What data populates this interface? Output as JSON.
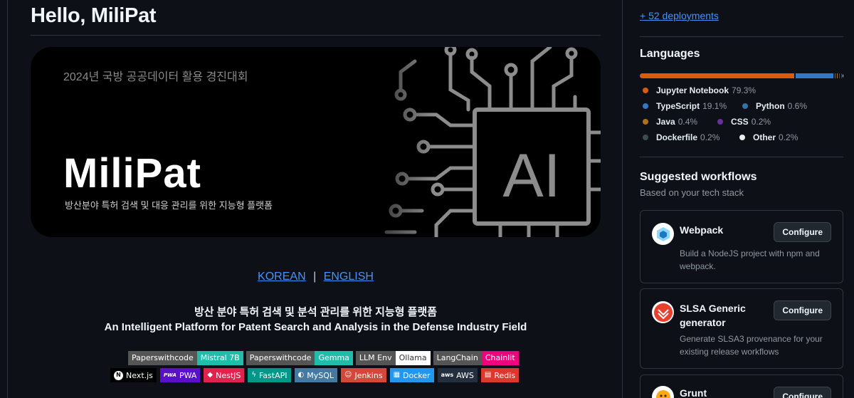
{
  "greeting": "Hello, MiliPat",
  "banner": {
    "subtitle": "2024년 국방 공공데이터 활용 경진대회",
    "title": "MiliPat",
    "tagline": "방산분야 특허 검색 및 대응 관리를 위한 지능형 플랫폼",
    "chip_label": "AI"
  },
  "language_links": {
    "korean": "KOREAN",
    "separator": "|",
    "english": "ENGLISH"
  },
  "description": {
    "korean": "방산 분야 특허 검색 및 분석 관리를 위한 지능형 플랫폼",
    "english": "An Intelligent Platform for Patent Search and Analysis in the Defense Industry Field"
  },
  "badges_row1": [
    {
      "key": "Paperswithcode",
      "value": "Mistral 7B",
      "color": "#20beaa"
    },
    {
      "key": "Paperswithcode",
      "value": "Gemma",
      "color": "#20beaa"
    },
    {
      "key": "LLM Env",
      "value": "Ollama",
      "color": "#ffffff",
      "text_color": "#333333"
    },
    {
      "key": "LangChain",
      "value": "Chainlit",
      "color": "#f1007e"
    }
  ],
  "badges_row2": [
    {
      "label": "Next.js",
      "icon": "nextjs-icon",
      "glyph": "N",
      "color": "#000000"
    },
    {
      "label": "PWA",
      "icon": "pwa-icon",
      "glyph": "PWA",
      "color": "#5a0fc8"
    },
    {
      "label": "NestJS",
      "icon": "nestjs-icon",
      "glyph": "◆",
      "color": "#e0234e"
    },
    {
      "label": "FastAPI",
      "icon": "fastapi-icon",
      "glyph": "ϟ",
      "color": "#009688"
    },
    {
      "label": "MySQL",
      "icon": "mysql-icon",
      "glyph": "◐",
      "color": "#4479a1"
    },
    {
      "label": "Jenkins",
      "icon": "jenkins-icon",
      "glyph": "☺",
      "color": "#d24939"
    },
    {
      "label": "Docker",
      "icon": "docker-icon",
      "glyph": "▦",
      "color": "#2496ed"
    },
    {
      "label": "AWS",
      "icon": "aws-icon",
      "glyph": "aws",
      "color": "#232f3e"
    },
    {
      "label": "Redis",
      "icon": "redis-icon",
      "glyph": "▤",
      "color": "#dc382d"
    }
  ],
  "sidebar": {
    "deployments_link": "+ 52 deployments",
    "languages_title": "Languages",
    "languages": [
      {
        "name": "Jupyter Notebook",
        "percent": "79.3%",
        "value": 79.3,
        "color": "#da5b0b"
      },
      {
        "name": "TypeScript",
        "percent": "19.1%",
        "value": 19.1,
        "color": "#3178c6"
      },
      {
        "name": "Python",
        "percent": "0.6%",
        "value": 0.6,
        "color": "#3572a5"
      },
      {
        "name": "Java",
        "percent": "0.4%",
        "value": 0.4,
        "color": "#b07219"
      },
      {
        "name": "CSS",
        "percent": "0.2%",
        "value": 0.2,
        "color": "#663399"
      },
      {
        "name": "Dockerfile",
        "percent": "0.2%",
        "value": 0.2,
        "color": "#384d54"
      },
      {
        "name": "Other",
        "percent": "0.2%",
        "value": 0.2,
        "color": "#ededed"
      }
    ],
    "workflows_title": "Suggested workflows",
    "workflows_subtitle": "Based on your tech stack",
    "workflows": [
      {
        "name": "Webpack",
        "description": "Build a NodeJS project with npm and webpack.",
        "button": "Configure",
        "icon": "webpack-icon"
      },
      {
        "name": "SLSA Generic generator",
        "description": "Generate SLSA3 provenance for your existing release workflows",
        "button": "Configure",
        "icon": "slsa-icon"
      },
      {
        "name": "Grunt",
        "description": "",
        "button": "Configure",
        "icon": "grunt-icon"
      }
    ]
  }
}
